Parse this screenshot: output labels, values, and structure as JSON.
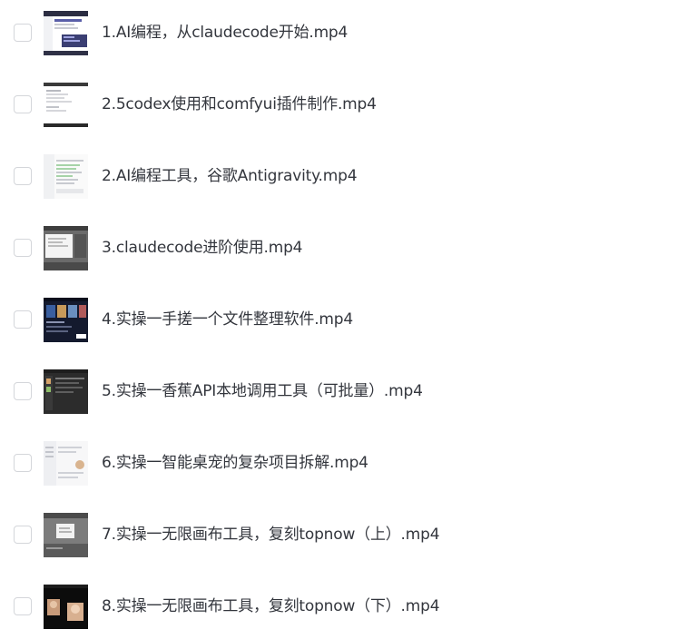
{
  "files": [
    {
      "name": "1.AI编程，从claudecode开始.mp4",
      "thumbnail_icon": "video-thumbnail-icon"
    },
    {
      "name": "2.5codex使用和comfyui插件制作.mp4",
      "thumbnail_icon": "video-thumbnail-icon"
    },
    {
      "name": "2.AI编程工具，谷歌Antigravity.mp4",
      "thumbnail_icon": "video-thumbnail-icon"
    },
    {
      "name": "3.claudecode进阶使用.mp4",
      "thumbnail_icon": "video-thumbnail-icon"
    },
    {
      "name": "4.实操一手搓一个文件整理软件.mp4",
      "thumbnail_icon": "video-thumbnail-icon"
    },
    {
      "name": "5.实操一香蕉API本地调用工具（可批量）.mp4",
      "thumbnail_icon": "video-thumbnail-icon"
    },
    {
      "name": "6.实操一智能桌宠的复杂项目拆解.mp4",
      "thumbnail_icon": "video-thumbnail-icon"
    },
    {
      "name": "7.实操一无限画布工具，复刻topnow（上）.mp4",
      "thumbnail_icon": "video-thumbnail-icon"
    },
    {
      "name": "8.实操一无限画布工具，复刻topnow（下）.mp4",
      "thumbnail_icon": "video-thumbnail-icon"
    }
  ],
  "colors": {
    "text": "#33363d",
    "checkbox_border": "#d4d6da",
    "background": "#ffffff"
  }
}
